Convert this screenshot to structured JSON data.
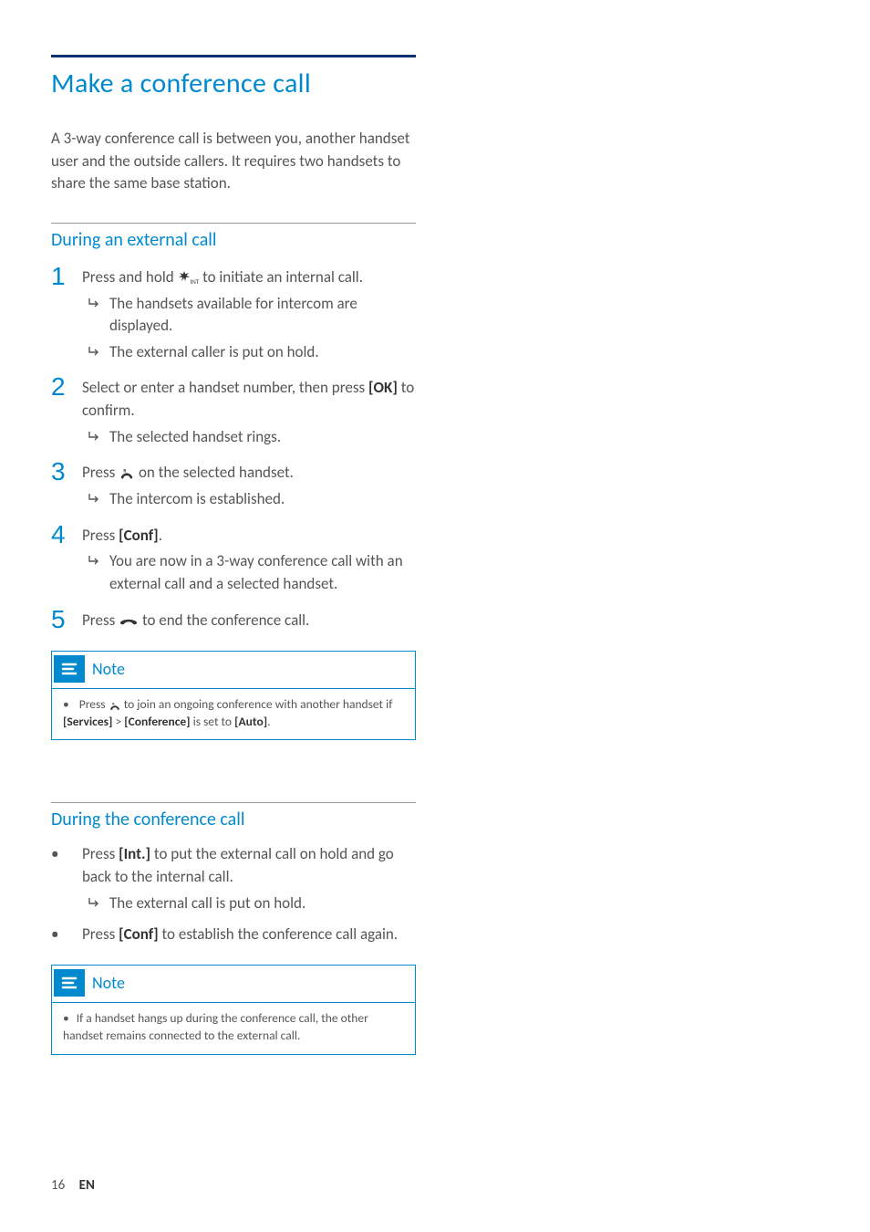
{
  "h1": "Make a conference call",
  "intro": "A 3-way conference call is between you, another handset user and the outside callers. It requires two handsets to share the same base station.",
  "sectionA": {
    "title": "During an external call",
    "steps": [
      {
        "num": "1",
        "prefix": "Press and hold ",
        "icon": "asterisk-int",
        "suffix": " to initiate an internal call.",
        "subs": [
          "The handsets available for intercom are displayed.",
          "The external caller is put on hold."
        ]
      },
      {
        "num": "2",
        "text_a": "Select or enter a handset number, then press ",
        "bold": "[OK]",
        "text_b": " to confirm.",
        "subs": [
          "The selected handset rings."
        ]
      },
      {
        "num": "3",
        "prefix": "Press ",
        "icon": "phone-r",
        "suffix": " on the selected handset.",
        "subs": [
          "The intercom is established."
        ]
      },
      {
        "num": "4",
        "text_a": "Press ",
        "bold": "[Conf]",
        "text_b": ".",
        "subs": [
          "You are now in a 3-way conference call with an external call and a selected handset."
        ]
      },
      {
        "num": "5",
        "prefix": "Press ",
        "icon": "hangup",
        "suffix": " to end the conference call.",
        "subs": []
      }
    ]
  },
  "noteA": {
    "label": "Note",
    "line_a": "Press ",
    "line_b": " to join an ongoing conference with another handset if ",
    "b1": "[Services]",
    "gt": " > ",
    "b2": "[Conference]",
    "line_c": " is set to ",
    "b3": "[Auto]",
    "line_d": "."
  },
  "sectionB": {
    "title": "During the conference call",
    "items": [
      {
        "a": "Press ",
        "bold": "[Int.]",
        "b": " to put the external call on hold and go back to the internal call.",
        "sub": "The external call is put on hold."
      },
      {
        "a": "Press ",
        "bold": "[Conf]",
        "b": " to establish the conference call again.",
        "sub": null
      }
    ]
  },
  "noteB": {
    "label": "Note",
    "text": "If a handset hangs up during the conference call, the other handset remains connected to the external call."
  },
  "footer": {
    "page": "16",
    "lang": "EN"
  }
}
